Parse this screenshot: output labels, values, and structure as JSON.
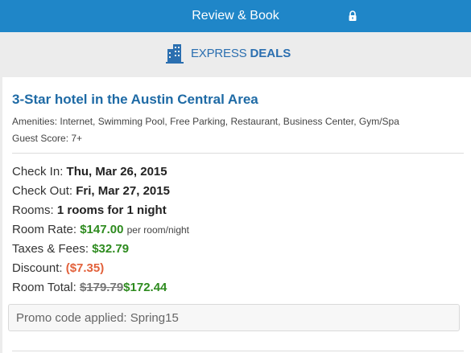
{
  "header": {
    "title": "Review & Book",
    "lock_icon": "lock-icon",
    "background": "#1f86c8"
  },
  "brand": {
    "icon": "building-icon",
    "express": "EXPRESS",
    "deals": "DEALS",
    "color": "#2b6fb0"
  },
  "hotel": {
    "title": "3-Star hotel in the Austin Central Area",
    "amenities": "Amenities: Internet, Swimming Pool, Free Parking, Restaurant, Business Center, Gym/Spa",
    "guest_score": "Guest Score: 7+"
  },
  "booking": {
    "check_in_label": "Check In:",
    "check_in_value": "Thu, Mar 26, 2015",
    "check_out_label": "Check Out:",
    "check_out_value": "Fri, Mar 27, 2015",
    "rooms_label": "Rooms:",
    "rooms_value": "1 rooms for 1 night",
    "rate_label": "Room Rate:",
    "rate_value": "$147.00",
    "rate_suffix": "per room/night",
    "taxes_label": "Taxes & Fees:",
    "taxes_value": "$32.79",
    "discount_label": "Discount:",
    "discount_value": "($7.35)",
    "total_label": "Room Total:",
    "total_original": "$179.79",
    "total_value": "$172.44"
  },
  "promo": {
    "text": "Promo code applied: Spring15"
  },
  "colors": {
    "price_green": "#2e8b1f",
    "discount_orange": "#e2613b",
    "title_blue": "#1e6aa5"
  }
}
